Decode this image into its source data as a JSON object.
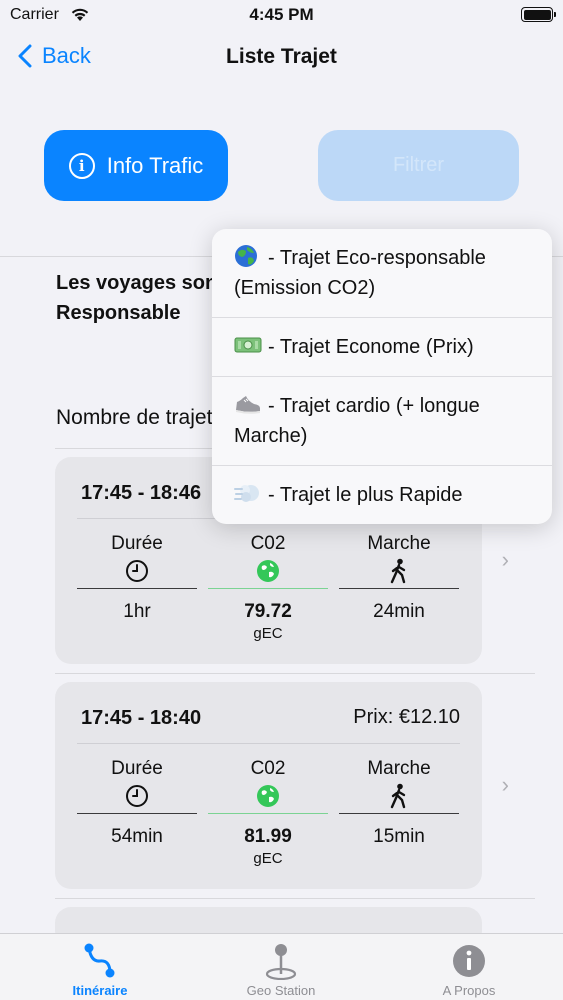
{
  "status_bar": {
    "carrier": "Carrier",
    "time": "4:45 PM"
  },
  "nav": {
    "back_label": "Back",
    "title": "Liste Trajet"
  },
  "buttons": {
    "info_trafic": "Info Trafic",
    "secondary": "Filtrer"
  },
  "info_text": "Les voyages sont classés par ordre Eco-Responsable",
  "count_label": "Nombre de trajets",
  "menu": {
    "items": [
      {
        "icon": "globe-emoji",
        "label": "- Trajet Eco-responsable (Emission CO2)"
      },
      {
        "icon": "money-emoji",
        "label": "- Trajet Econome (Prix)"
      },
      {
        "icon": "sneaker-emoji",
        "label": "- Trajet cardio (+ longue Marche)"
      },
      {
        "icon": "dash-emoji",
        "label": "- Trajet le plus Rapide"
      }
    ]
  },
  "trips": [
    {
      "time": "17:45 - 18:46",
      "price": "",
      "duree_label": "Durée",
      "duree_value": "1hr",
      "co2_label": "C02",
      "co2_value": "79.72",
      "co2_unit": "gEC",
      "marche_label": "Marche",
      "marche_value": "24min"
    },
    {
      "time": "17:45 - 18:40",
      "price": "Prix:  €12.10",
      "duree_label": "Durée",
      "duree_value": "54min",
      "co2_label": "C02",
      "co2_value": "81.99",
      "co2_unit": "gEC",
      "marche_label": "Marche",
      "marche_value": "15min"
    }
  ],
  "tabs": [
    {
      "label": "Itinéraire",
      "icon": "route-icon",
      "active": true
    },
    {
      "label": "Geo Station",
      "icon": "map-pin-icon",
      "active": false
    },
    {
      "label": "A Propos",
      "icon": "info-icon",
      "active": false
    }
  ],
  "colors": {
    "accent": "#0a84ff",
    "eco_green": "#34c759"
  }
}
